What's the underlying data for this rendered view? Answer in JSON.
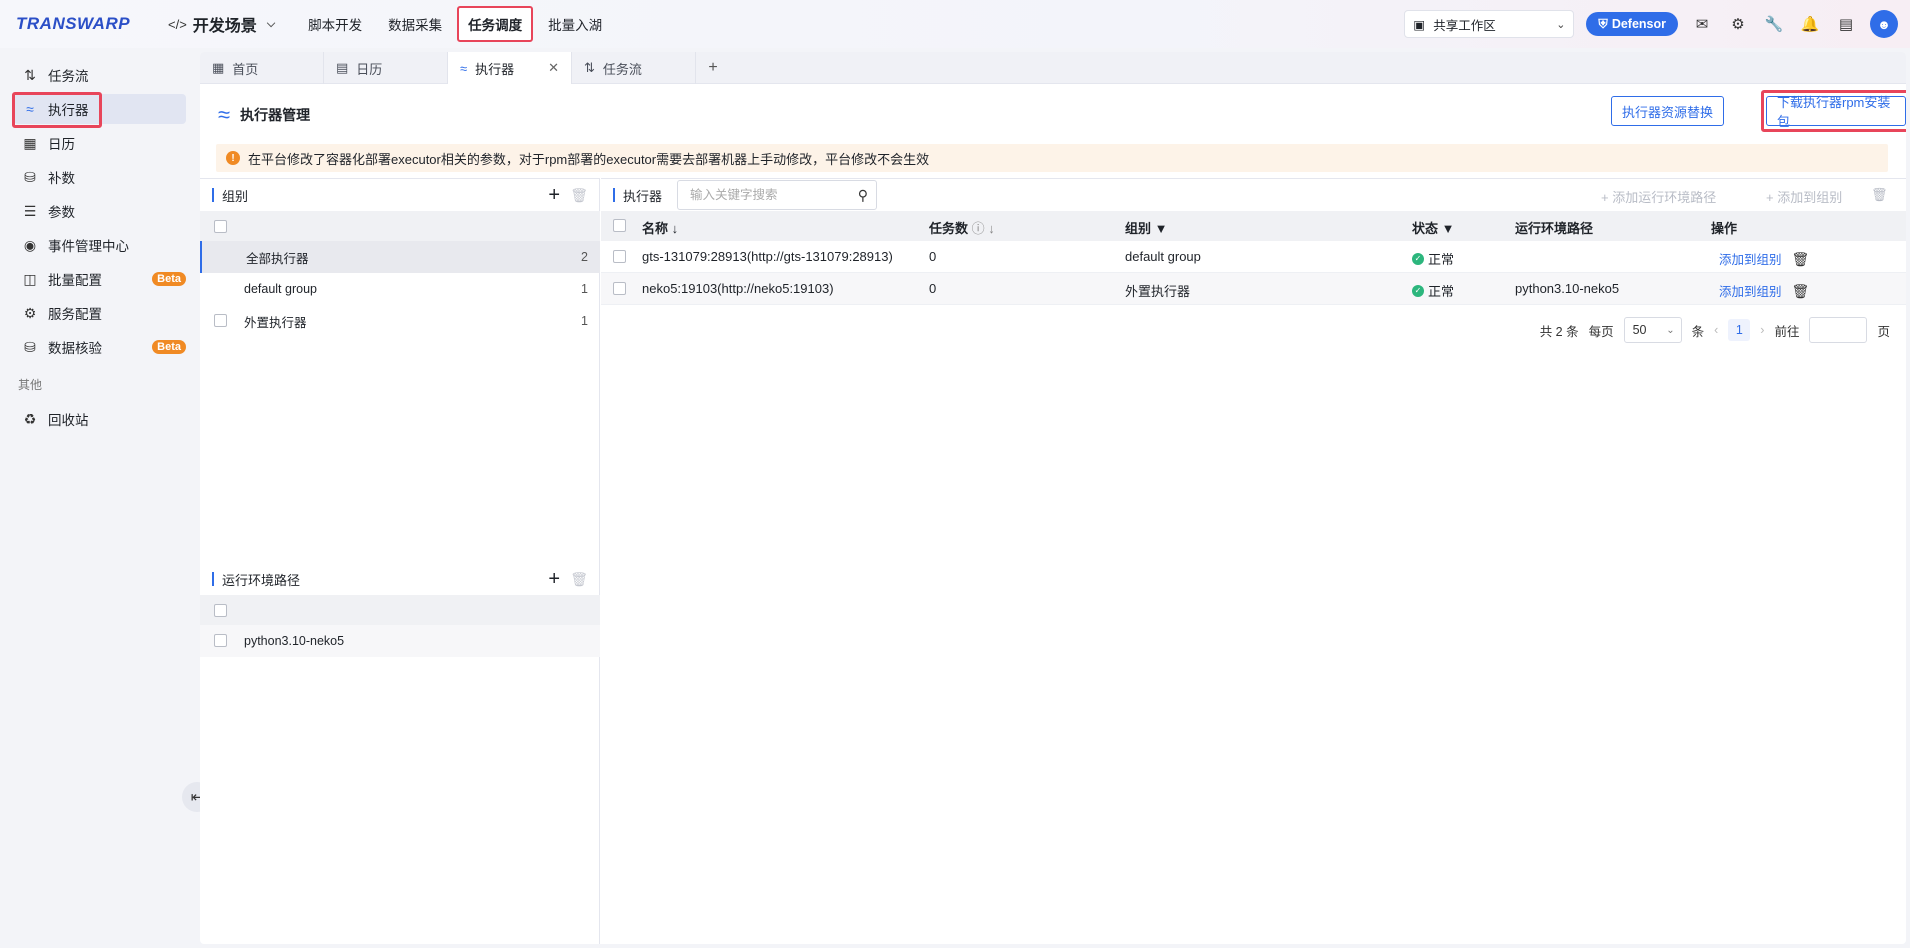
{
  "topbar": {
    "logo": "TRANSWARP",
    "scene_icon": "</>",
    "scene": "开发场景",
    "nav": [
      "脚本开发",
      "数据采集",
      "任务调度",
      "批量入湖"
    ],
    "active_nav": "任务调度",
    "workspace": "共享工作区",
    "defensor": "Defensor",
    "icons": [
      "send-icon",
      "gear-icon",
      "wrench-icon",
      "bell-icon",
      "presentation-icon"
    ]
  },
  "sidebar": {
    "items": [
      {
        "label": "任务流",
        "icon": "flow-icon"
      },
      {
        "label": "执行器",
        "icon": "executor-icon"
      },
      {
        "label": "日历",
        "icon": "calendar-icon"
      },
      {
        "label": "补数",
        "icon": "database-icon"
      },
      {
        "label": "参数",
        "icon": "sliders-icon"
      },
      {
        "label": "事件管理中心",
        "icon": "event-icon"
      },
      {
        "label": "批量配置",
        "icon": "batch-icon",
        "badge": "Beta"
      },
      {
        "label": "服务配置",
        "icon": "gear-icon"
      },
      {
        "label": "数据核验",
        "icon": "check-db-icon",
        "badge": "Beta"
      }
    ],
    "group_other": "其他",
    "recycle": "回收站"
  },
  "tabs": [
    {
      "label": "首页",
      "icon": "grid-icon"
    },
    {
      "label": "日历",
      "icon": "calendar-icon"
    },
    {
      "label": "执行器",
      "icon": "executor-icon",
      "active": true
    },
    {
      "label": "任务流",
      "icon": "flow-icon"
    }
  ],
  "header": {
    "title": "执行器管理",
    "btn_replace": "执行器资源替换",
    "btn_download": "下载执行器rpm安装包"
  },
  "alert": "在平台修改了容器化部署executor相关的参数，对于rpm部署的executor需要去部署机器上手动修改，平台修改不会生效",
  "groups": {
    "title": "组别",
    "rows": [
      {
        "name": "全部执行器",
        "count": "2"
      },
      {
        "name": "default group",
        "count": "1"
      },
      {
        "name": "外置执行器",
        "count": "1"
      }
    ]
  },
  "envpaths": {
    "title": "运行环境路径",
    "rows": [
      {
        "name": "python3.10-neko5"
      }
    ]
  },
  "executors": {
    "title": "执行器",
    "search_placeholder": "输入关键字搜索",
    "add_env": "+ 添加运行环境路径",
    "add_group": "+ 添加到组别",
    "columns": {
      "name": "名称 ↓",
      "tasks": "任务数",
      "tasks_sort": "↓",
      "group": "组别",
      "status": "状态",
      "env": "运行环境路径",
      "ops": "操作"
    },
    "rows": [
      {
        "name": "gts-131079:28913(http://gts-131079:28913)",
        "tasks": "0",
        "group": "default group",
        "status": "正常",
        "env": "",
        "op": "添加到组别"
      },
      {
        "name": "neko5:19103(http://neko5:19103)",
        "tasks": "0",
        "group": "外置执行器",
        "status": "正常",
        "env": "python3.10-neko5",
        "op": "添加到组别"
      }
    ]
  },
  "pager": {
    "total": "共 2 条",
    "per_page_label": "每页",
    "per_page": "50",
    "unit": "条",
    "page": "1",
    "goto_label": "前往",
    "goto_unit": "页"
  },
  "colors": {
    "accent": "#2f6de8",
    "highlight": "#e8455a",
    "beta": "#f08a24",
    "ok": "#2cb67d"
  }
}
